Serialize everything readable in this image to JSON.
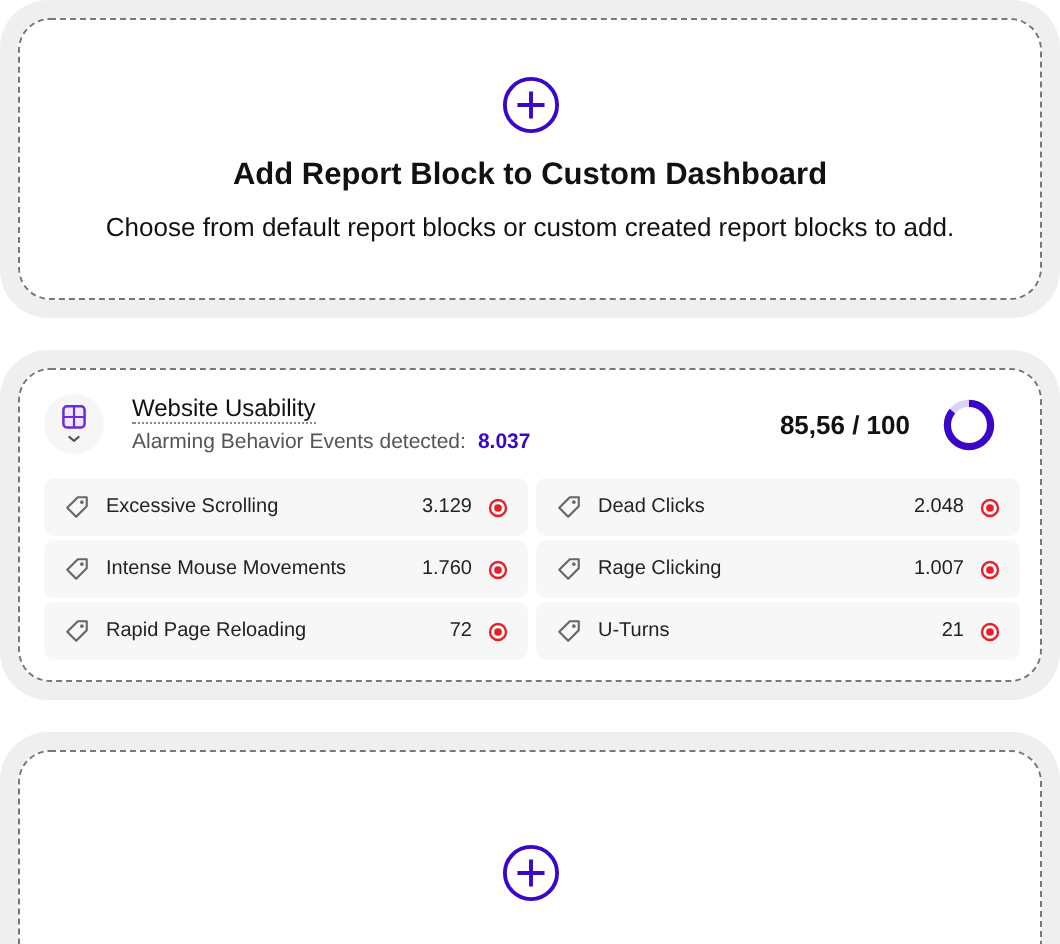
{
  "add_block": {
    "title": "Add Report Block to Custom Dashboard",
    "subtitle": "Choose from default report blocks or custom created report blocks to add."
  },
  "report_block": {
    "title": "Website Usability",
    "summary_label": "Alarming Behavior Events detected:",
    "summary_value": "8.037",
    "score": "85,56 / 100",
    "level": 0.8556,
    "metrics": [
      {
        "name": "Excessive Scrolling",
        "value": "3.129"
      },
      {
        "name": "Dead Clicks",
        "value": "2.048"
      },
      {
        "name": "Intense Mouse Movements",
        "value": "1.760"
      },
      {
        "name": "Rage Clicking",
        "value": "1.007"
      },
      {
        "name": "Rapid Page Reloading",
        "value": "72"
      },
      {
        "name": "U-Turns",
        "value": "21"
      }
    ]
  },
  "empty_block": {
    "kind": "add"
  }
}
